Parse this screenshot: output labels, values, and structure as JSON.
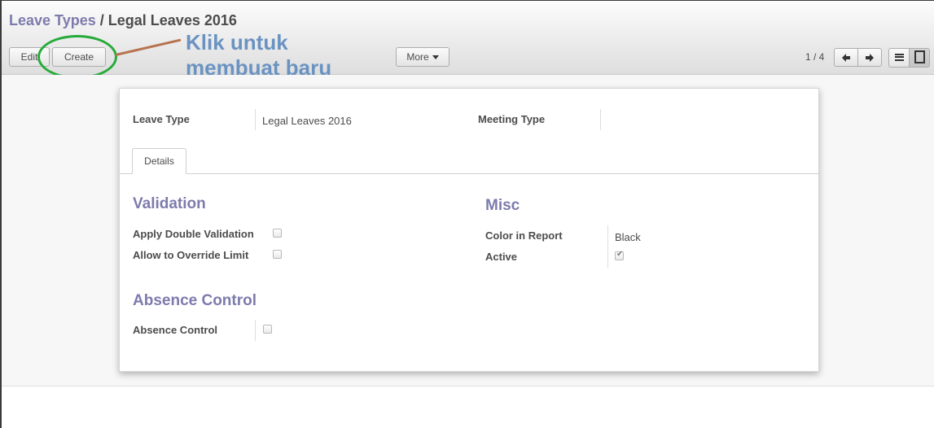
{
  "breadcrumb": {
    "parent": "Leave Types",
    "separator": "/",
    "current": "Legal Leaves 2016"
  },
  "toolbar": {
    "edit_label": "Edit",
    "create_label": "Create",
    "more_label": "More"
  },
  "pager": {
    "counter": "1 / 4"
  },
  "icons": {
    "prev": "arrow-left-icon",
    "next": "arrow-right-icon",
    "list_view": "list-view-icon",
    "form_view": "form-view-icon",
    "more_caret": "caret-down-icon"
  },
  "annotation": {
    "line1": "Klik untuk",
    "line2": "membuat baru",
    "color_text": "#6a93c2",
    "color_ellipse": "#26ab3a",
    "color_line": "#b77350"
  },
  "form": {
    "leave_type_label": "Leave Type",
    "leave_type_value": "Legal Leaves 2016",
    "meeting_type_label": "Meeting Type",
    "meeting_type_value": "",
    "tabs": [
      {
        "label": "Details",
        "active": true
      }
    ],
    "validation": {
      "title": "Validation",
      "apply_double_validation_label": "Apply Double Validation",
      "apply_double_validation_checked": false,
      "allow_override_limit_label": "Allow to Override Limit",
      "allow_override_limit_checked": false
    },
    "misc": {
      "title": "Misc",
      "color_in_report_label": "Color in Report",
      "color_in_report_value": "Black",
      "active_label": "Active",
      "active_checked": true
    },
    "absence_control": {
      "title": "Absence Control",
      "absence_control_label": "Absence Control",
      "absence_control_checked": false
    }
  },
  "colors": {
    "accent": "#7c7bad",
    "text": "#4c4c4c"
  }
}
